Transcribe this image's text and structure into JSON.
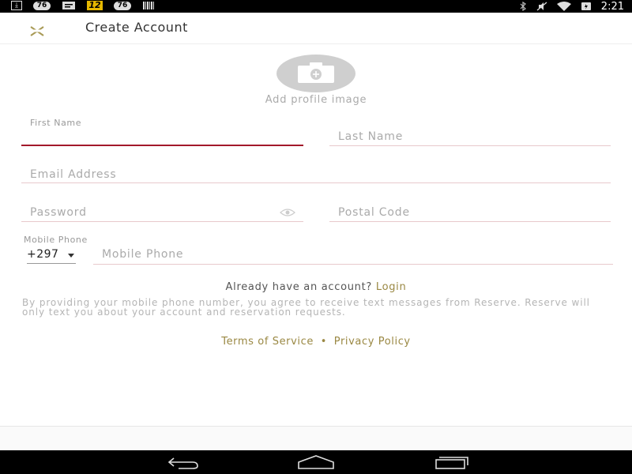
{
  "status_bar": {
    "time": "2:21",
    "badge_text": "12"
  },
  "header": {
    "title": "Create Account"
  },
  "avatar": {
    "caption": "Add profile image"
  },
  "form": {
    "first_name": {
      "label": "First Name",
      "value": ""
    },
    "last_name": {
      "placeholder": "Last Name"
    },
    "email": {
      "placeholder": "Email Address"
    },
    "password": {
      "placeholder": "Password"
    },
    "postal_code": {
      "placeholder": "Postal Code"
    },
    "mobile": {
      "label": "Mobile Phone",
      "country_code": "+297",
      "placeholder": "Mobile Phone"
    }
  },
  "login_prompt": {
    "text": "Already have an account?",
    "link": "Login"
  },
  "disclaimer": "By providing your mobile phone number, you agree to receive text messages from Reserve. Reserve will only text you about your account and reservation requests.",
  "legal": {
    "terms": "Terms of Service",
    "separator": "•",
    "privacy": "Privacy Policy"
  },
  "colors": {
    "accent": "#9a8843",
    "active_underline": "#a3182b",
    "field_underline": "#e8c9cc"
  }
}
